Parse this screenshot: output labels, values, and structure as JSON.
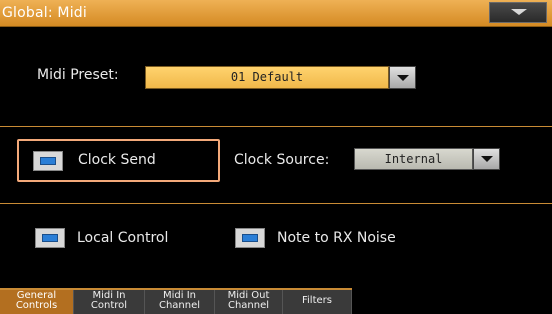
{
  "window": {
    "title": "Global: Midi"
  },
  "midi_preset": {
    "label": "Midi Preset:",
    "value": "01 Default"
  },
  "clock_send": {
    "label": "Clock Send",
    "checked": true
  },
  "clock_source": {
    "label": "Clock Source:",
    "value": "Internal"
  },
  "local_control": {
    "label": "Local Control",
    "checked": true
  },
  "note_to_rx_noise": {
    "label": "Note to RX Noise",
    "checked": true
  },
  "tabs": [
    {
      "line1": "General",
      "line2": "Controls",
      "active": true
    },
    {
      "line1": "Midi In",
      "line2": "Control",
      "active": false
    },
    {
      "line1": "Midi In",
      "line2": "Channel",
      "active": false
    },
    {
      "line1": "Midi Out",
      "line2": "Channel",
      "active": false
    },
    {
      "line1": "Filters",
      "line2": "",
      "active": false
    }
  ],
  "colors": {
    "title_bar": "#e39d3a",
    "dropdown_field": "#f5c15a",
    "checkbox_mark": "#2a7ed6",
    "highlight_frame": "#f3a97a",
    "active_tab": "#b36f20"
  },
  "icons": {
    "page_menu": "chevron-down-icon",
    "dropdown": "triangle-down-icon"
  }
}
